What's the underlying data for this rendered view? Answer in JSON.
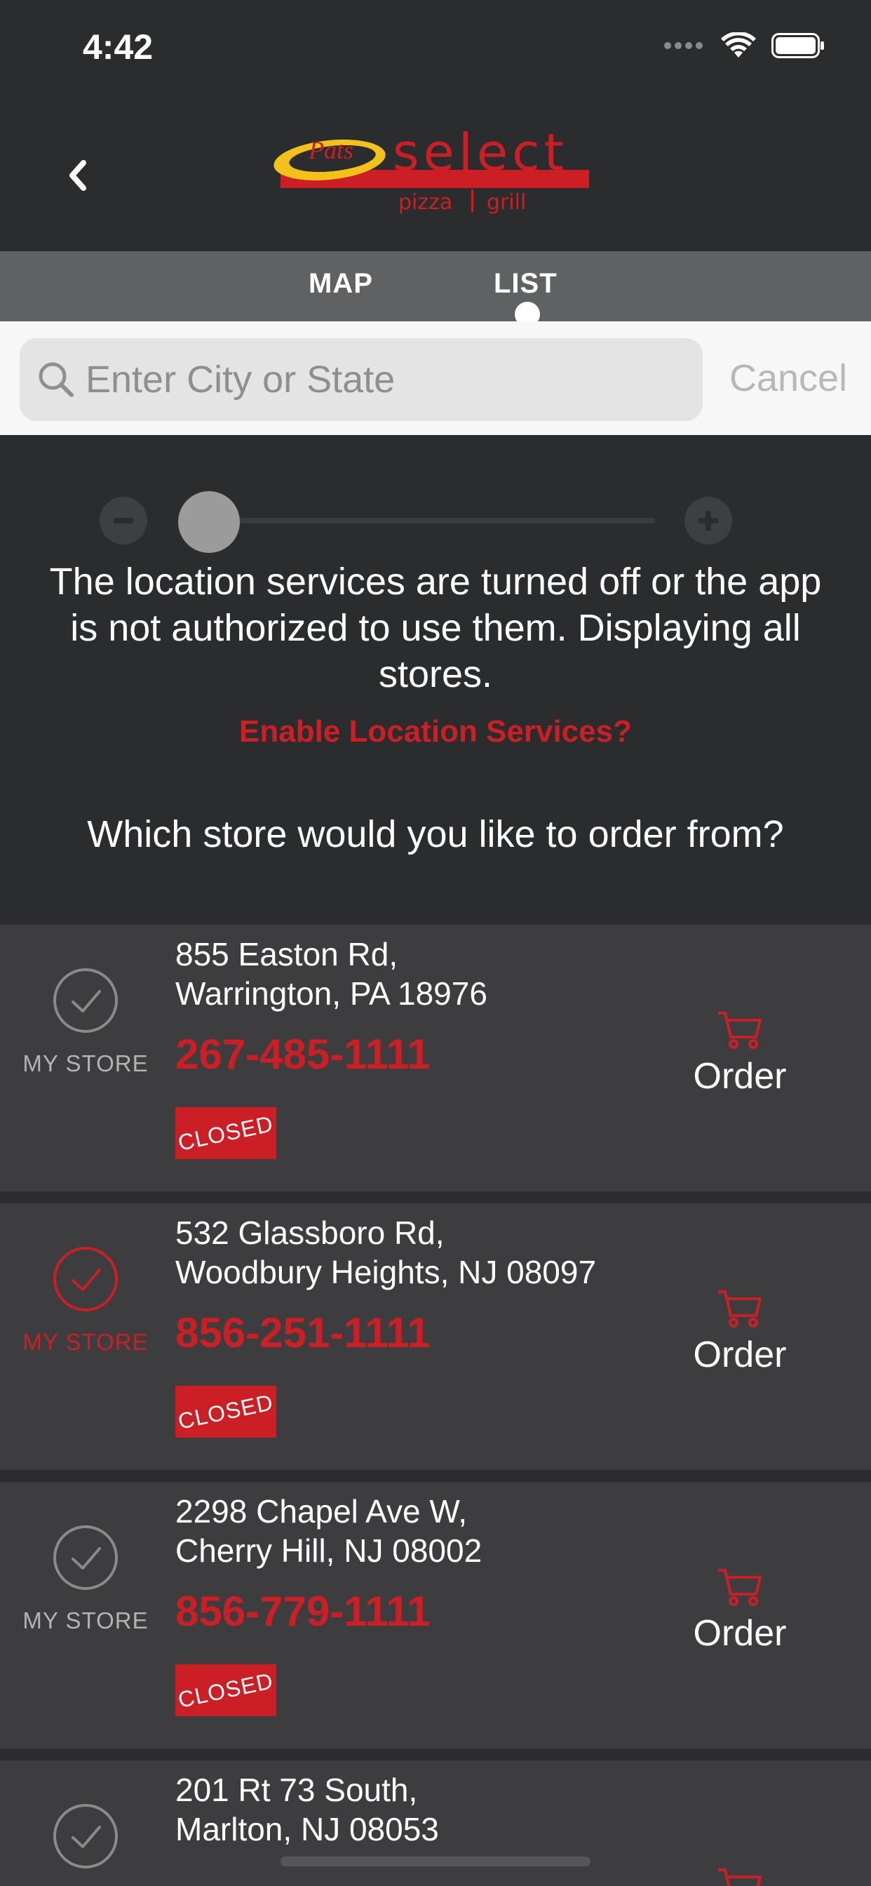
{
  "status_bar": {
    "time": "4:42"
  },
  "header": {
    "logo_script": "Pats",
    "logo_main": "select",
    "logo_sub_left": "pizza",
    "logo_sub_right": "grill"
  },
  "tabs": [
    {
      "label": "MAP"
    },
    {
      "label": "LIST",
      "selected": true
    }
  ],
  "search": {
    "placeholder": "Enter City or State",
    "value": "",
    "cancel_label": "Cancel"
  },
  "distance_slider": {
    "value": 0
  },
  "location": {
    "message": "The location services are turned off or the app is not authorized to use them. Displaying all stores.",
    "enable_label": "Enable Location Services?"
  },
  "prompt": "Which store would you like to order from?",
  "stores": [
    {
      "address_line1": "855 Easton Rd,",
      "address_line2": "Warrington, PA 18976",
      "phone": "267-485-1111",
      "status": "CLOSED",
      "my_store_label": "MY STORE",
      "my_store": false,
      "order_label": "Order"
    },
    {
      "address_line1": "532 Glassboro Rd,",
      "address_line2": "Woodbury Heights, NJ 08097",
      "phone": "856-251-1111",
      "status": "CLOSED",
      "my_store_label": "MY STORE",
      "my_store": true,
      "order_label": "Order"
    },
    {
      "address_line1": "2298 Chapel Ave W,",
      "address_line2": "Cherry Hill, NJ 08002",
      "phone": "856-779-1111",
      "status": "CLOSED",
      "my_store_label": "MY STORE",
      "my_store": false,
      "order_label": "Order"
    },
    {
      "address_line1": "201 Rt 73 South,",
      "address_line2": "Marlton, NJ 08053",
      "phone": "",
      "status": "",
      "my_store_label": "",
      "my_store": false,
      "order_label": ""
    }
  ],
  "colors": {
    "accent": "#cc1f25",
    "background": "#2b2c2e",
    "card": "#3d3d3f",
    "tab_bar": "#5f6163",
    "logo_yellow": "#f2c21b"
  },
  "icons": [
    "back-chevron-icon",
    "signal-icon",
    "wifi-icon",
    "battery-icon",
    "search-icon",
    "zoom-out-icon",
    "zoom-in-icon",
    "check-circle-icon",
    "cart-icon"
  ]
}
